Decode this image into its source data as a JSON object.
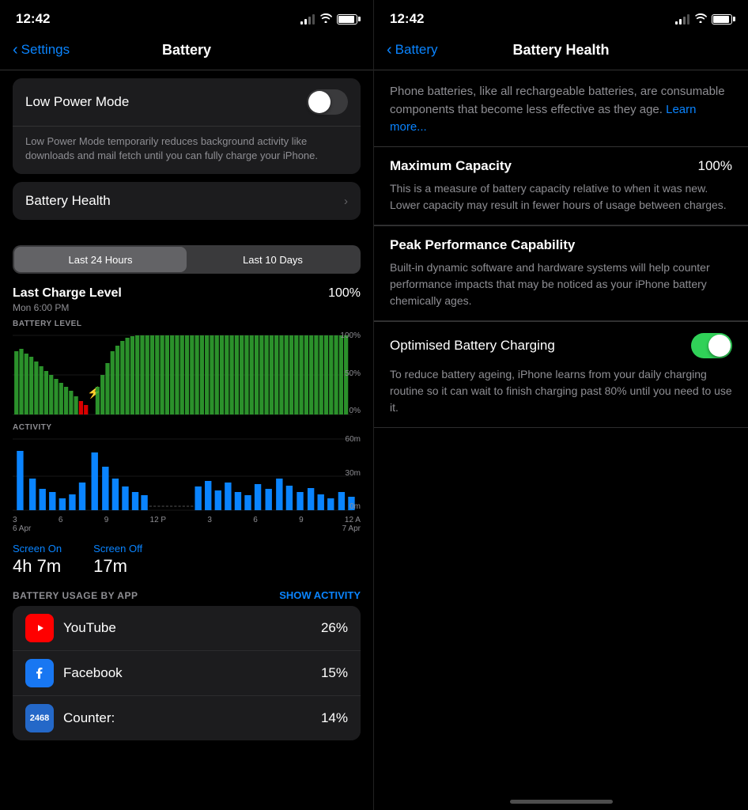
{
  "left": {
    "status": {
      "time": "12:42"
    },
    "nav": {
      "back_label": "Settings",
      "title": "Battery"
    },
    "low_power_mode": {
      "label": "Low Power Mode",
      "description": "Low Power Mode temporarily reduces background activity like downloads and mail fetch until you can fully charge your iPhone.",
      "toggle_on": false
    },
    "battery_health": {
      "label": "Battery Health"
    },
    "segment": {
      "option1": "Last 24 Hours",
      "option2": "Last 10 Days"
    },
    "charge_level": {
      "title": "Last Charge Level",
      "subtitle": "Mon 6:00 PM",
      "value": "100%"
    },
    "battery_chart_label": "BATTERY LEVEL",
    "battery_y_labels": [
      "100%",
      "50%",
      "0%"
    ],
    "activity_chart_label": "ACTIVITY",
    "activity_y_labels": [
      "60m",
      "30m",
      "0m"
    ],
    "x_labels": [
      "3",
      "6",
      "9",
      "12 P",
      "3",
      "6",
      "9",
      "12 A"
    ],
    "date_labels": {
      "left": "6 Apr",
      "right": "7 Apr"
    },
    "screen_on": {
      "label": "Screen On",
      "value": "4h 7m"
    },
    "screen_off": {
      "label": "Screen Off",
      "value": "17m"
    },
    "battery_usage_by_app": "BATTERY USAGE BY APP",
    "show_activity": "SHOW ACTIVITY",
    "apps": [
      {
        "name": "YouTube",
        "pct": "26%",
        "icon": "youtube"
      },
      {
        "name": "Facebook",
        "pct": "15%",
        "icon": "facebook"
      },
      {
        "name": "Counter:",
        "pct": "14%",
        "icon": "counter"
      }
    ]
  },
  "right": {
    "status": {
      "time": "12:42"
    },
    "nav": {
      "back_label": "Battery",
      "title": "Battery Health"
    },
    "intro": {
      "text": "Phone batteries, like all rechargeable batteries, are consumable components that become less effective as they age. ",
      "learn_more": "Learn more..."
    },
    "max_capacity": {
      "label": "Maximum Capacity",
      "value": "100%",
      "description": "This is a measure of battery capacity relative to when it was new. Lower capacity may result in fewer hours of usage between charges."
    },
    "peak_performance": {
      "label": "Peak Performance Capability",
      "description": "Built-in dynamic software and hardware systems will help counter performance impacts that may be noticed as your iPhone battery chemically ages."
    },
    "optimised_charging": {
      "label": "Optimised Battery Charging",
      "toggle_on": true,
      "description": "To reduce battery ageing, iPhone learns from your daily charging routine so it can wait to finish charging past 80% until you need to use it."
    }
  }
}
